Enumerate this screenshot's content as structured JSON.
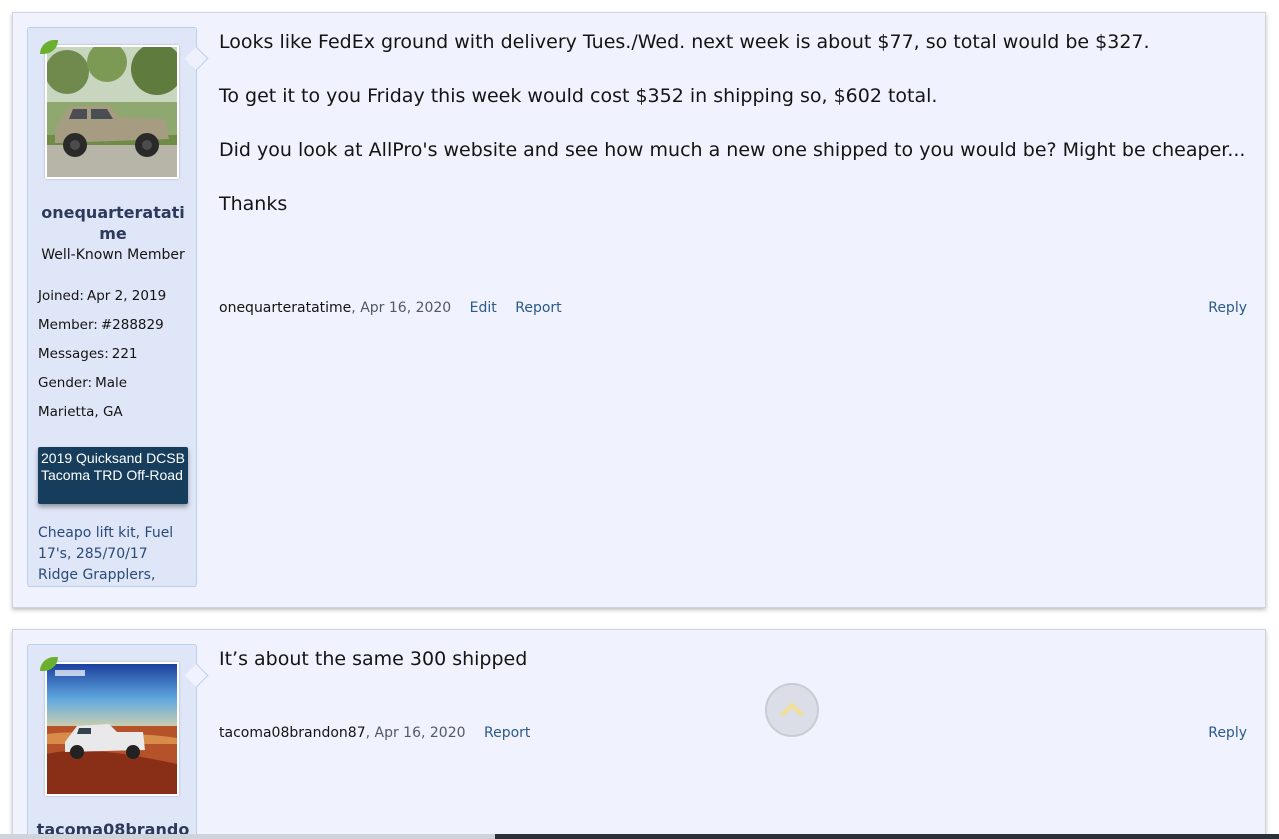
{
  "posts": [
    {
      "username": "onequarteratatime",
      "user_title": "Well-Known Member",
      "extras": [
        {
          "key": "Joined:",
          "value": "Apr 2, 2019"
        },
        {
          "key": "Member:",
          "value": "#288829"
        },
        {
          "key": "Messages:",
          "value": "221"
        },
        {
          "key": "Gender:",
          "value": "Male"
        },
        {
          "key": "Marietta, GA",
          "value": ""
        }
      ],
      "vehicle": "2019 Quicksand DCSB Tacoma TRD Off-Road",
      "signature": "Cheapo lift kit, Fuel 17's, 285/70/17 Ridge Grapplers,",
      "message": [
        "Looks like FedEx ground with delivery Tues./Wed. next week is about $77, so total would be $327.",
        "To get it to you Friday this week would cost $352 in shipping so, $602 total.",
        "Did you look at AllPro's website and see how much a new one shipped to you would be? Might be cheaper...",
        "Thanks"
      ],
      "author": "onequarteratatime",
      "date": "Apr 16, 2020",
      "actions": [
        "Edit",
        "Report"
      ],
      "reply": "Reply"
    },
    {
      "username": "tacoma08brando",
      "message": [
        "It’s about the same 300 shipped"
      ],
      "author": "tacoma08brandon87",
      "date": "Apr 16, 2020",
      "actions": [
        "Report"
      ],
      "reply": "Reply"
    }
  ],
  "icons": {
    "scroll_top": "chevron-up-icon",
    "staff_leaf": "leaf-icon"
  },
  "colors": {
    "post_bg": "#f0f2fd",
    "user_block_bg": "#dfe6f7",
    "vehicle_badge_bg": "#173d5c",
    "link": "#2a5a8c"
  }
}
